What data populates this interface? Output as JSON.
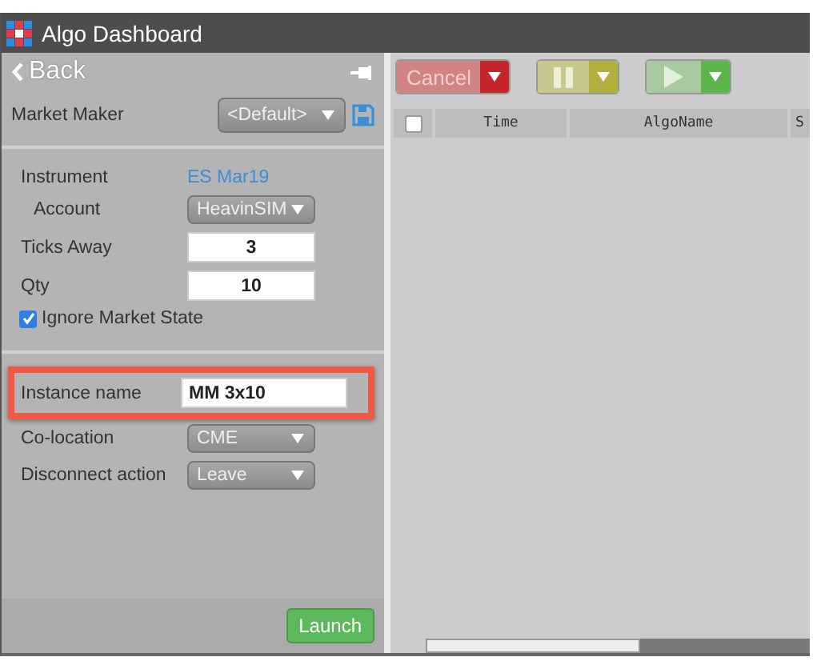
{
  "window": {
    "title": "Algo Dashboard"
  },
  "left_panel": {
    "back": "Back",
    "template_label": "Market Maker",
    "template_value": "<Default>",
    "fields": [
      {
        "kind": "link",
        "label": "Instrument",
        "value": "ES Mar19"
      },
      {
        "kind": "dropdown",
        "label": "Account",
        "value": "HeavinSIM",
        "indent": true
      },
      {
        "kind": "input",
        "label": "Ticks Away",
        "value": "3"
      },
      {
        "kind": "input",
        "label": "Qty",
        "value": "10"
      },
      {
        "kind": "checkbox",
        "label": "Ignore Market State",
        "checked": true
      }
    ],
    "fields_2": [
      {
        "kind": "text",
        "label": "Instance name",
        "value": "MM 3x10",
        "highlighted": true
      },
      {
        "kind": "dropdown",
        "label": "Co-location",
        "value": "CME"
      },
      {
        "kind": "dropdown",
        "label": "Disconnect action",
        "value": "Leave"
      }
    ],
    "launch": "Launch"
  },
  "toolbar": [
    {
      "kind": "cancel",
      "label": "Cancel"
    },
    {
      "kind": "pause"
    },
    {
      "kind": "play"
    }
  ],
  "table": {
    "select_all": {
      "checked": false
    },
    "columns": [
      "Time",
      "AlgoName",
      "S"
    ]
  }
}
